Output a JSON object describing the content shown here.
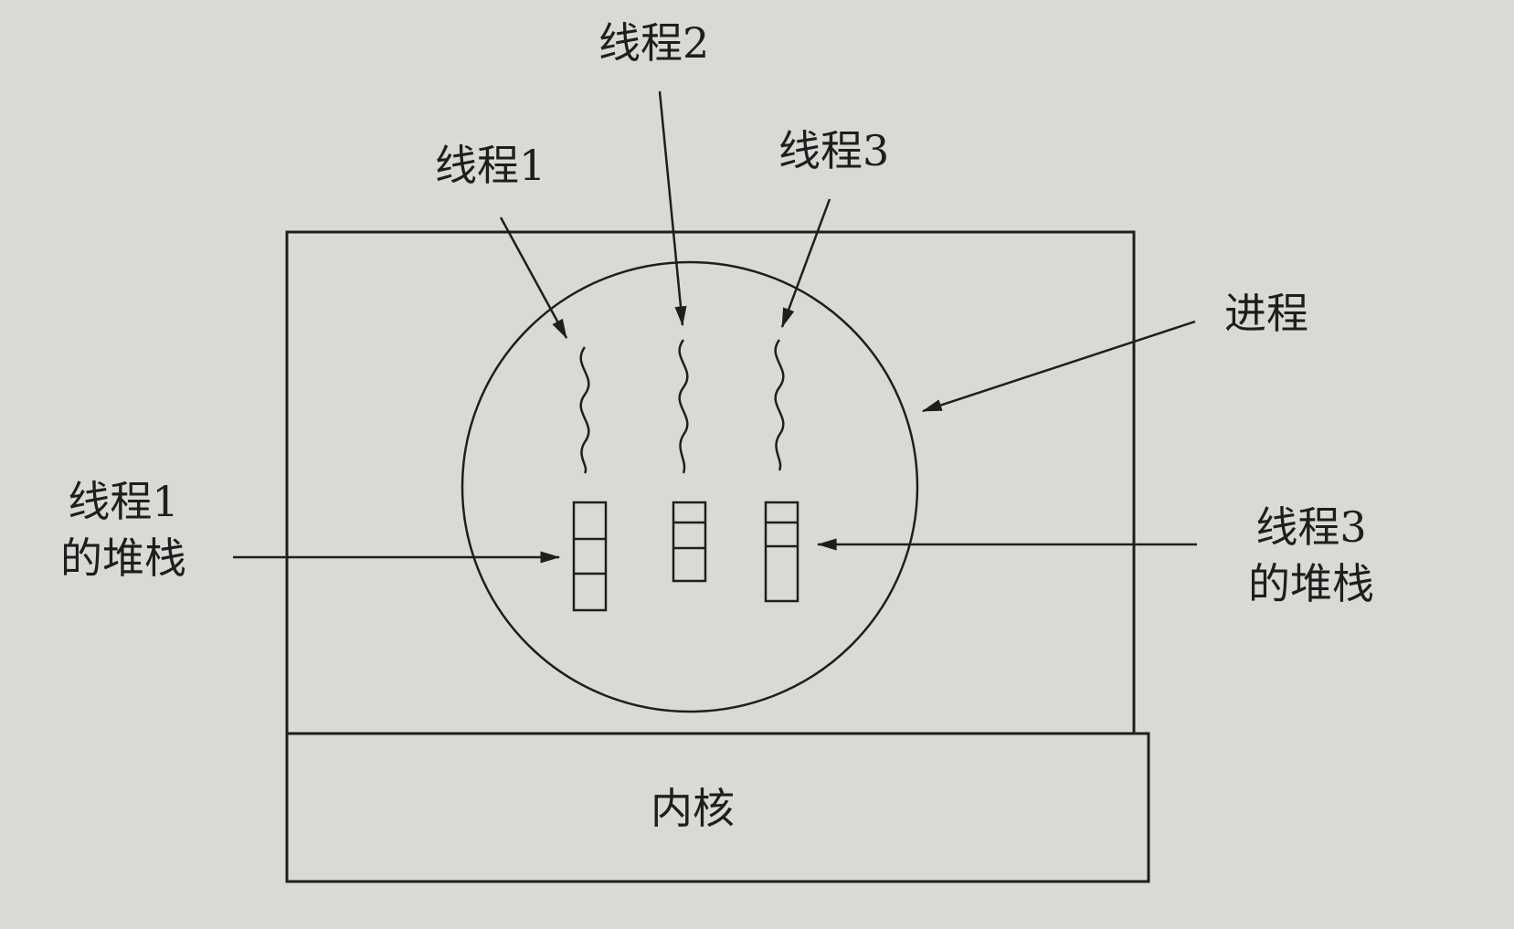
{
  "labels": {
    "thread1": "线程1",
    "thread2": "线程2",
    "thread3": "线程3",
    "process": "进程",
    "stack1_line1": "线程1",
    "stack1_line2": "的堆栈",
    "stack3_line1": "线程3",
    "stack3_line2": "的堆栈",
    "kernel": "内核"
  },
  "colors": {
    "ink": "#1e1e1e",
    "paper": "#d9d9d6"
  }
}
